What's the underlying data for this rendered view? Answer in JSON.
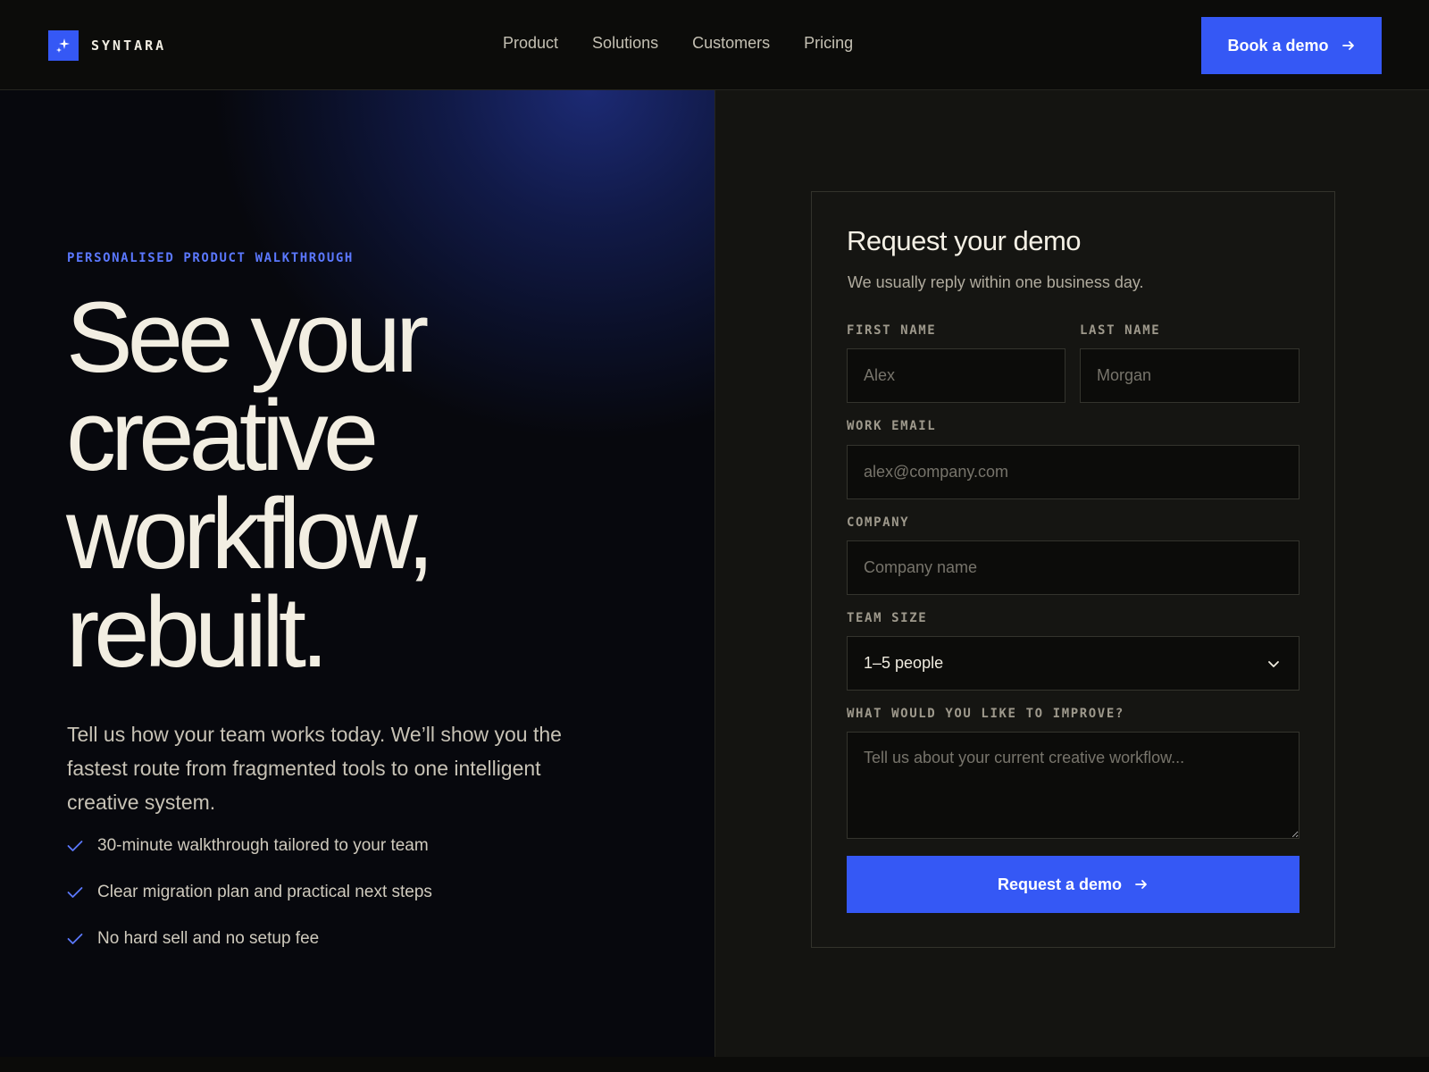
{
  "brand": {
    "name": "SYNTARA",
    "icon": "sparkles-icon",
    "accent": "#3558f5"
  },
  "nav": {
    "links": [
      "Product",
      "Solutions",
      "Customers",
      "Pricing"
    ],
    "cta_label": "Book a demo",
    "cta_icon": "arrow-right-icon"
  },
  "hero": {
    "eyebrow": "PERSONALISED PRODUCT WALKTHROUGH",
    "headline_lines": [
      "See your",
      "creative",
      "workflow,",
      "rebuilt."
    ],
    "description": "Tell us how your team works today. We’ll show you the fastest route from fragmented tools to one intelligent creative system.",
    "benefits": [
      "30-minute walkthrough tailored to your team",
      "Clear migration plan and practical next steps",
      "No hard sell and no setup fee"
    ],
    "benefit_icon": "check-icon"
  },
  "form": {
    "title": "Request your demo",
    "subtitle": "We usually reply within one business day.",
    "first_name": {
      "label": "FIRST NAME",
      "placeholder": "Alex"
    },
    "last_name": {
      "label": "LAST NAME",
      "placeholder": "Morgan"
    },
    "email": {
      "label": "WORK EMAIL",
      "placeholder": "alex@company.com"
    },
    "company": {
      "label": "COMPANY",
      "placeholder": "Company name"
    },
    "team_size": {
      "label": "TEAM SIZE",
      "value": "1–5 people",
      "icon": "chevron-down-icon"
    },
    "improve": {
      "label": "WHAT WOULD YOU LIKE TO IMPROVE?",
      "placeholder": "Tell us about your current creative workflow..."
    },
    "submit_label": "Request a demo",
    "submit_icon": "arrow-right-icon"
  }
}
